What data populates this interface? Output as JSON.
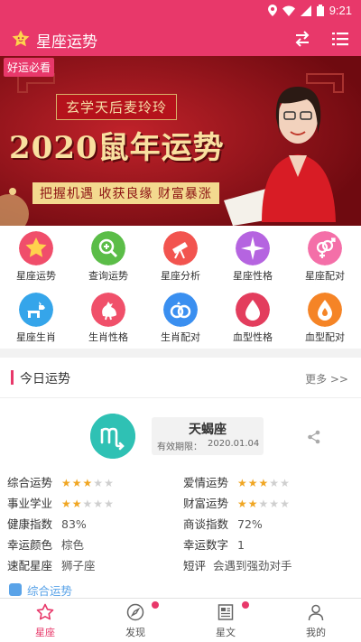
{
  "status": {
    "time": "9:21"
  },
  "app": {
    "title": "星座运势"
  },
  "banner": {
    "badge": "好运必看",
    "subtitle": "玄学天后麦玲玲",
    "title": "2020鼠年运势",
    "tagline": "把握机遇  收获良缘  财富暴涨",
    "dots": 5,
    "active_dot": 0
  },
  "grid": [
    {
      "label": "星座运势",
      "color": "#f04e6b",
      "icon": "star-icon"
    },
    {
      "label": "查询运势",
      "color": "#5bbd48",
      "icon": "magnifier-icon"
    },
    {
      "label": "星座分析",
      "color": "#f2544f",
      "icon": "telescope-icon"
    },
    {
      "label": "星座性格",
      "color": "#b564e0",
      "icon": "sparkle-icon"
    },
    {
      "label": "星座配对",
      "color": "#f46fa8",
      "icon": "gender-icon"
    },
    {
      "label": "星座生肖",
      "color": "#35a5ea",
      "icon": "dog-icon"
    },
    {
      "label": "生肖性格",
      "color": "#f0506a",
      "icon": "rooster-icon"
    },
    {
      "label": "生肖配对",
      "color": "#3a8ff0",
      "icon": "rings-icon"
    },
    {
      "label": "血型性格",
      "color": "#e33d5d",
      "icon": "drop-icon"
    },
    {
      "label": "血型配对",
      "color": "#f58426",
      "icon": "flame-drop-icon"
    }
  ],
  "today": {
    "title": "今日运势",
    "more": "更多 >>",
    "sign": {
      "symbol": "♏",
      "name": "天蝎座",
      "valid_label": "有效期限：",
      "valid_date": "2020.01.04"
    },
    "ratings": [
      {
        "label": "综合运势",
        "stars": 3
      },
      {
        "label": "爱情运势",
        "stars": 3
      },
      {
        "label": "事业学业",
        "stars": 2
      },
      {
        "label": "财富运势",
        "stars": 2
      }
    ],
    "details": [
      {
        "label": "健康指数",
        "value": "83%"
      },
      {
        "label": "商谈指数",
        "value": "72%"
      },
      {
        "label": "幸运颜色",
        "value": "棕色"
      },
      {
        "label": "幸运数字",
        "value": "1"
      },
      {
        "label": "速配星座",
        "value": "狮子座"
      },
      {
        "label": "短评",
        "value": "会遇到强劲对手"
      }
    ],
    "section_link": "综合运势"
  },
  "tabs": [
    {
      "label": "星座",
      "icon": "star-outline-icon",
      "active": true,
      "dot": false
    },
    {
      "label": "发现",
      "icon": "compass-icon",
      "active": false,
      "dot": true
    },
    {
      "label": "星文",
      "icon": "article-icon",
      "active": false,
      "dot": true
    },
    {
      "label": "我的",
      "icon": "person-icon",
      "active": false,
      "dot": false
    }
  ],
  "colors": {
    "accent": "#e8386a",
    "banner_red": "#8b0f16",
    "gold": "#f9e0a0"
  }
}
